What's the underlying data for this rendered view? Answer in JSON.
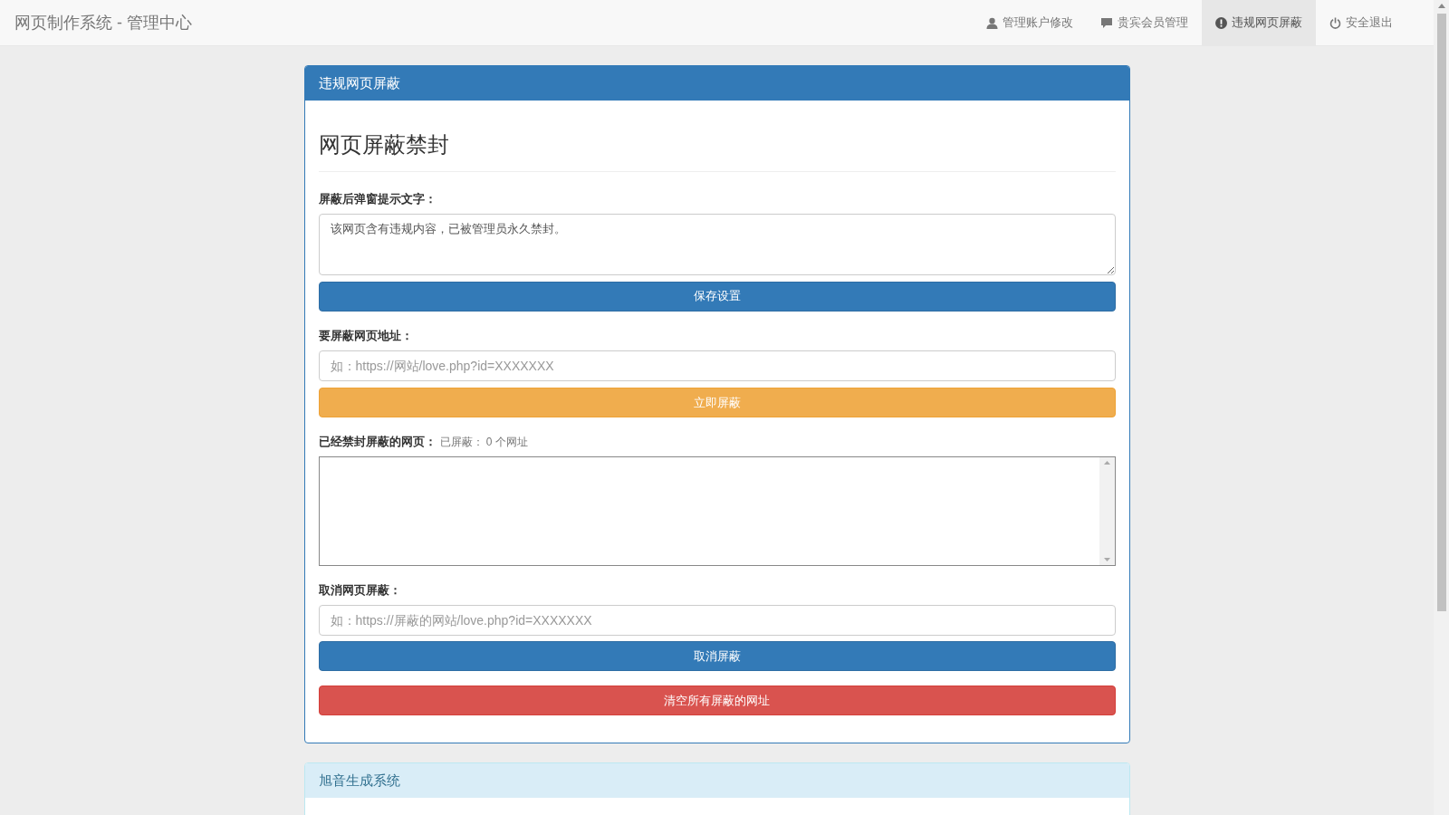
{
  "navbar": {
    "brand": "网页制作系统 - 管理中心",
    "items": [
      {
        "label": "管理账户修改",
        "selected": false
      },
      {
        "label": "贵宾会员管理",
        "selected": false
      },
      {
        "label": "违规网页屏蔽",
        "selected": true
      },
      {
        "label": "安全退出",
        "selected": false
      }
    ]
  },
  "panel": {
    "title": "违规网页屏蔽",
    "heading": "网页屏蔽禁封",
    "message": {
      "label": "屏蔽后弹窗提示文字：",
      "value": "该网页含有违规内容，已被管理员永久禁封。",
      "button": "保存设置"
    },
    "block": {
      "label": "要屏蔽网页地址：",
      "placeholder": "如：https://网站/love.php?id=XXXXXXX",
      "button": "立即屏蔽"
    },
    "blocked": {
      "label": "已经禁封屏蔽的网页：",
      "count_prefix": "已屏蔽：",
      "count": "0",
      "count_suffix": "个网址"
    },
    "unblock": {
      "label": "取消网页屏蔽：",
      "placeholder": "如：https://屏蔽的网站/love.php?id=XXXXXXX",
      "button": "取消屏蔽"
    },
    "clear_button": "清空所有屏蔽的网址"
  },
  "second_panel": {
    "title": "旭音生成系统"
  }
}
